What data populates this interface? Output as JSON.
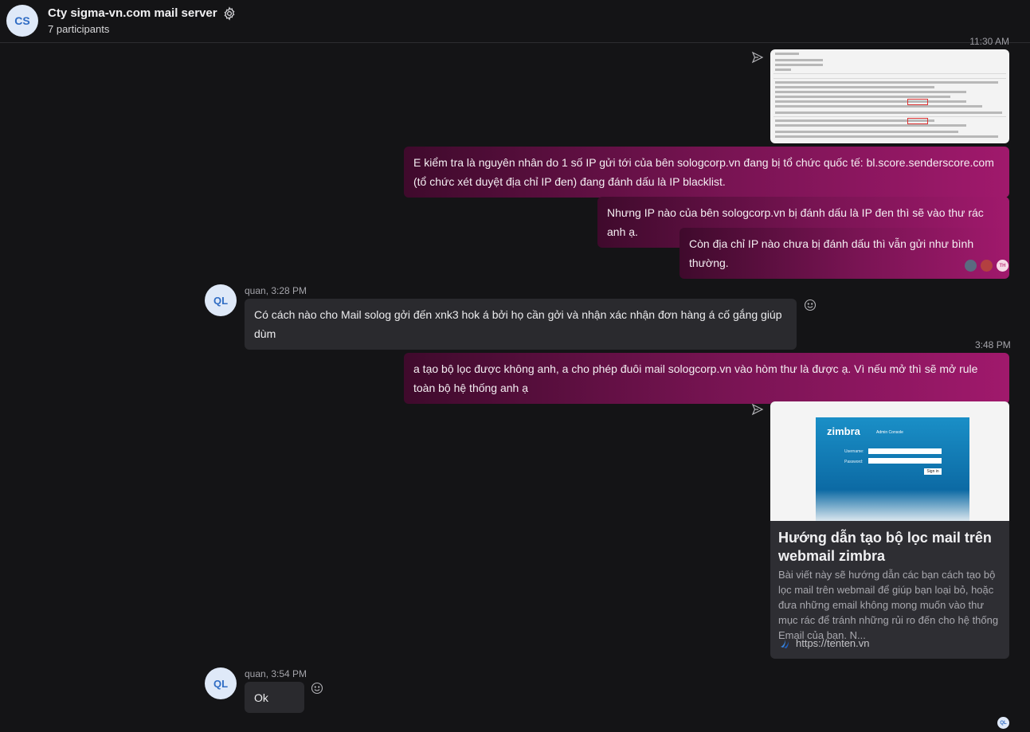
{
  "header": {
    "avatar_initials": "CS",
    "title": "Cty sigma-vn.com mail server",
    "participants": "7 participants"
  },
  "messages": {
    "top_timestamp": "11:30 AM",
    "msg1": "E kiểm tra là nguyên nhân do 1 số IP gửi tới của bên sologcorp.vn đang bị tổ chức quốc tế: bl.score.senderscore.com (tổ chức xét duyệt địa chỉ IP đen) đang đánh dấu là IP blacklist.",
    "msg2": "Nhưng IP nào của bên sologcorp.vn bị đánh dấu là IP đen thì sẽ vào thư rác anh ạ.",
    "msg3": "Còn địa chỉ IP nào chưa bị đánh dấu thì vẫn gửi như bình thường.",
    "quan1_sender": "quan, 3:28 PM",
    "quan1_initials": "QL",
    "quan1_text": "Có cách nào cho Mail solog gởi đến xnk3 hok á bởi họ cần gởi và nhận xác nhận đơn hàng á cố gắng giúp dùm",
    "time_348": "3:48 PM",
    "msg4": "a tạo bộ lọc được không anh, a cho phép đuôi mail sologcorp.vn vào hòm thư là được ạ. Vì nếu mở thì sẽ mở rule toàn bộ hệ thống anh ạ",
    "quan2_sender": "quan, 3:54 PM",
    "quan2_initials": "QL",
    "quan2_text": "Ok",
    "seen_initials": "TH",
    "seen_last": "QL"
  },
  "link_card": {
    "brand": "zimbra",
    "brand_sub": "Admin Console",
    "username_label": "Username:",
    "password_label": "Password:",
    "signin": "Sign in",
    "title": "Hướng dẫn tạo bộ lọc mail trên webmail zimbra",
    "description": "Bài viết này sẽ hướng dẫn các bạn cách tạo bộ lọc mail trên webmail để giúp bạn loại bỏ, hoặc đưa những email không mong muốn vào thư mục rác để tránh những rủi ro đến cho hệ thống Email của bạn. N...",
    "url": "https://tenten.vn"
  },
  "colors": {
    "outgoing_start": "#3f0a2c",
    "outgoing_end": "#a0196c",
    "incoming": "#2a2a2e",
    "background": "#141416"
  }
}
